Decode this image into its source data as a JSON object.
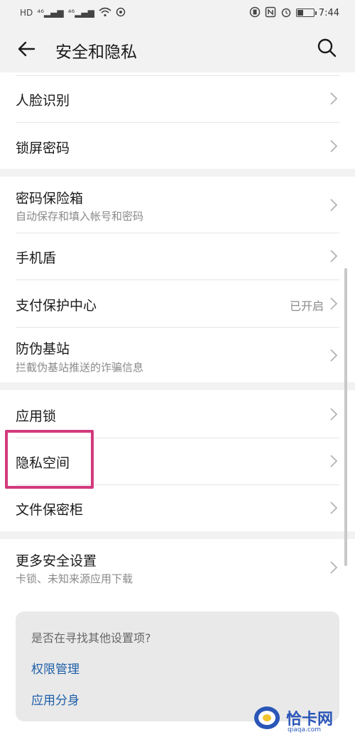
{
  "status_bar": {
    "left_badges": [
      "HD",
      "⁴⁶",
      "⁴⁶"
    ],
    "time": "7:44",
    "battery_level": 0.35
  },
  "app_bar": {
    "title": "安全和隐私"
  },
  "section1": {
    "items": [
      {
        "title": "人脸识别"
      },
      {
        "title": "锁屏密码"
      }
    ]
  },
  "section2": {
    "items": [
      {
        "title": "密码保险箱",
        "subtitle": "自动保存和填入帐号和密码"
      },
      {
        "title": "手机盾"
      },
      {
        "title": "支付保护中心",
        "value": "已开启"
      },
      {
        "title": "防伪基站",
        "subtitle": "拦截伪基站推送的诈骗信息"
      }
    ]
  },
  "section3": {
    "items": [
      {
        "title": "应用锁"
      },
      {
        "title": "隐私空间"
      },
      {
        "title": "文件保密柜"
      }
    ]
  },
  "section4": {
    "items": [
      {
        "title": "更多安全设置",
        "subtitle": "卡锁、未知来源应用下载"
      }
    ]
  },
  "suggestions": {
    "question": "是否在寻找其他设置项?",
    "links": [
      "权限管理",
      "应用分身"
    ]
  },
  "watermark": {
    "text": "恰卡网",
    "domain": "qiaqa.com"
  },
  "colors": {
    "highlight": "#d33a7d",
    "link": "#1f5fa8",
    "background": "#f2f2f2"
  }
}
